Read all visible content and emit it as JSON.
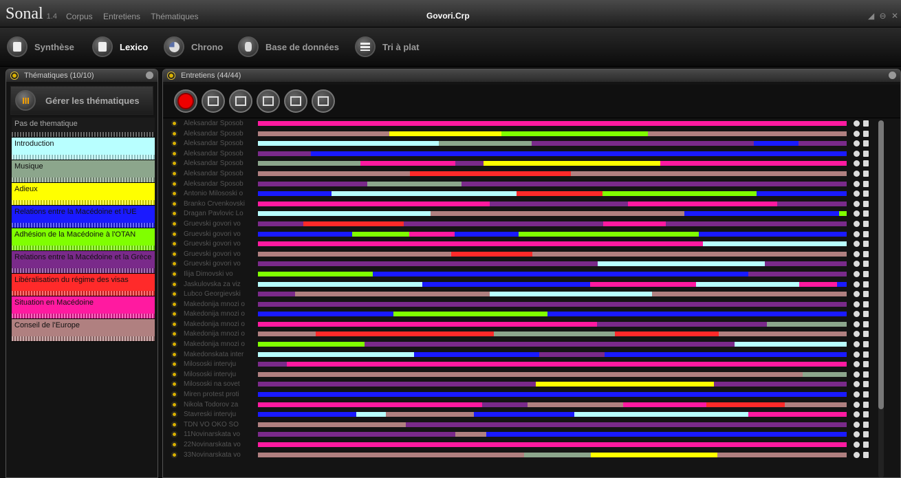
{
  "app": {
    "logo": "Sonal",
    "version": "1.4",
    "menu": [
      "Corpus",
      "Entretiens",
      "Thématiques"
    ],
    "window_title": "Govori.Crp",
    "controls": [
      "◢",
      "⊖",
      "✕"
    ]
  },
  "toolbar": {
    "items": [
      {
        "label": "Synthèse",
        "active": false
      },
      {
        "label": "Lexico",
        "active": true
      },
      {
        "label": "Chrono",
        "active": false
      },
      {
        "label": "Base de données",
        "active": false
      },
      {
        "label": "Tri à plat",
        "active": false
      }
    ]
  },
  "themes_panel": {
    "title": "Thématiques (10/10)",
    "manage_label": "Gérer les thématiques",
    "items": [
      {
        "label": "Pas de thematique",
        "color": "#1b1b1b"
      },
      {
        "label": "Introduction",
        "color": "#b8ffff"
      },
      {
        "label": "Musique",
        "color": "#8ca68c"
      },
      {
        "label": "Adieux",
        "color": "#ffff00"
      },
      {
        "label": "Relations entre la Macédoine et l'UE",
        "color": "#1a1aff"
      },
      {
        "label": "Adhésion de la Macédoine à l'OTAN",
        "color": "#80ff00"
      },
      {
        "label": "Relations entre la Macédoine et la Grèce",
        "color": "#7a2a8a"
      },
      {
        "label": "Libéralisation du régime des visas",
        "color": "#ff2a2a"
      },
      {
        "label": "Situation en Macédoine",
        "color": "#ff1aa0"
      },
      {
        "label": "Conseil de l'Europe",
        "color": "#b08080"
      }
    ]
  },
  "interviews_panel": {
    "title": "Entretiens (44/44)",
    "rows": [
      "Aleksandar Sposob",
      "Aleksandar Sposob",
      "Aleksandar Sposob",
      "Aleksandar Sposob",
      "Aleksandar Sposob",
      "Aleksandar Sposob",
      "Aleksandar Sposob",
      "Antonio Milososki o",
      "Branko Crvenkovski",
      "Dragan Pavlovic Lo",
      "Gruevski govori vo",
      "Gruevski govori vo",
      "Gruevski govori vo",
      "Gruevski govori vo",
      "Gruevski govori vo",
      "Ilija Dimovski vo",
      "Jaskulovska za viz",
      "Lubco Georgievski",
      "Makedonija mnozi o",
      "Makedonija mnozi o",
      "Makedonija mnozi o",
      "Makedonija mnozi o",
      "Makedonija mnozi o",
      "Makedonskata inter",
      "Milososki intervju",
      "Milososki intervju",
      "Milososki na sovet",
      "Miren protest proti",
      "Nikola Todorov za",
      "Stavreski intervju",
      "TDN VO OKO SO",
      "11Novinarskata vo",
      "22Novinarskata vo",
      "33Novinarskata vo"
    ]
  }
}
